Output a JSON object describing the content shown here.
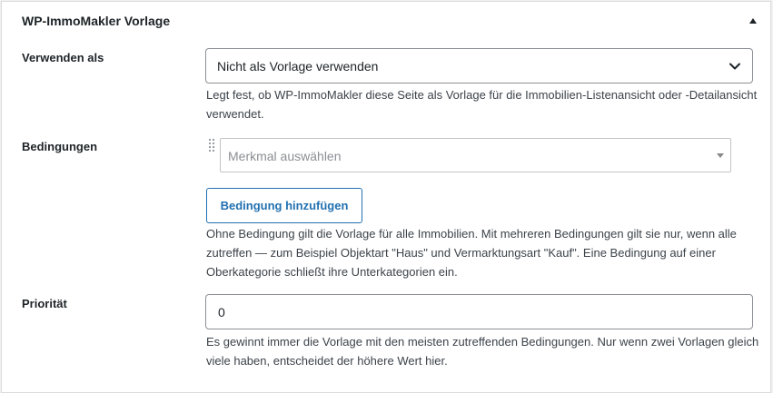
{
  "panel": {
    "title": "WP-ImmoMakler Vorlage",
    "toggle_icon": "triangle-up-icon"
  },
  "fields": {
    "usage": {
      "label": "Verwenden als",
      "selected": "Nicht als Vorlage verwenden",
      "description": "Legt fest, ob WP-ImmoMakler diese Seite als Vorlage für die Immobilien-Listenansicht oder -Detailansicht verwendet."
    },
    "conditions": {
      "label": "Bedingungen",
      "feature_placeholder": "Merkmal auswählen",
      "add_button_label": "Bedingung hinzufügen",
      "description": "Ohne Bedingung gilt die Vorlage für alle Immobilien. Mit mehreren Bedingungen gilt sie nur, wenn alle zutreffen — zum Beispiel Objektart \"Haus\" und Vermarktungsart \"Kauf\". Eine Bedingung auf einer Oberkategorie schließt ihre Unterkategorien ein."
    },
    "priority": {
      "label": "Priorität",
      "value": "0",
      "description": "Es gewinnt immer die Vorlage mit den meisten zutreffenden Bedingungen. Nur wenn zwei Vorlagen gleich viele haben, entscheidet der höhere Wert hier."
    }
  },
  "colors": {
    "accent": "#2271b1",
    "text": "#1d2327",
    "muted": "#3c434a",
    "border": "#8c8f94"
  }
}
